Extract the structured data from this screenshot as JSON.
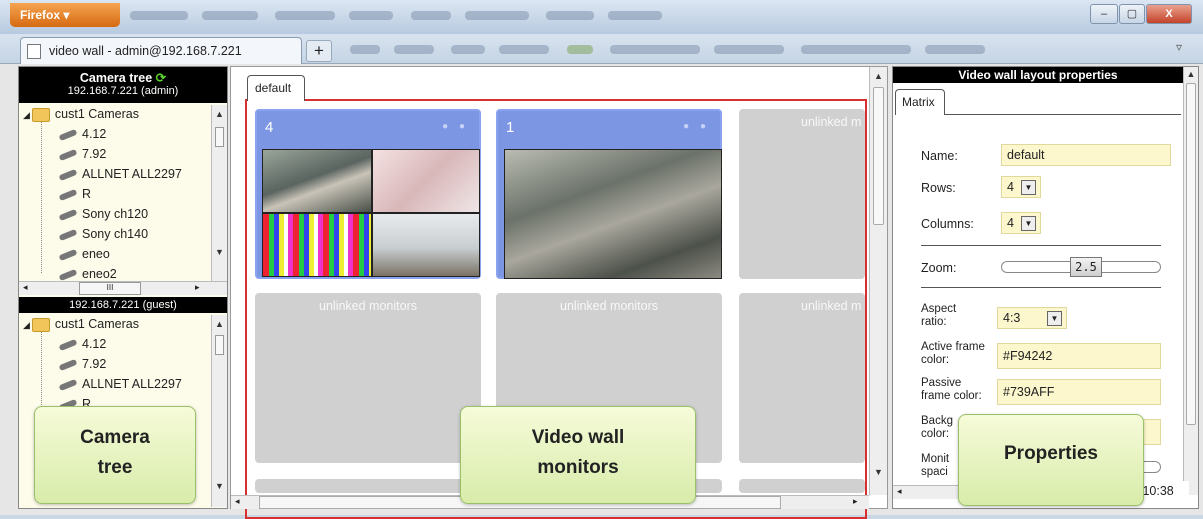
{
  "browser": {
    "app_button": "Firefox",
    "tab_title": "video wall - admin@192.168.7.221",
    "new_tab_symbol": "+",
    "window_controls": {
      "minimize": "–",
      "maximize": "▢",
      "close": "X"
    }
  },
  "camera_tree": {
    "title": "Camera tree",
    "servers": [
      {
        "address": "192.168.7.221 (admin)",
        "folder": "cust1 Cameras",
        "cameras": [
          "4.12",
          "7.92",
          "ALLNET ALL2297",
          "R",
          "Sony ch120",
          "Sony ch140",
          "eneo",
          "eneo2"
        ]
      },
      {
        "address": "192.168.7.221 (guest)",
        "folder": "cust1 Cameras",
        "cameras": [
          "4.12",
          "7.92",
          "ALLNET ALL2297",
          "R"
        ]
      }
    ],
    "hscroll_grip": "III"
  },
  "video_wall": {
    "layout_tab": "default",
    "monitors": [
      {
        "number": "4",
        "state": "active"
      },
      {
        "number": "1",
        "state": "active"
      },
      {
        "label": "unlinked m"
      },
      {
        "label": "unlinked monitors"
      },
      {
        "label": "unlinked monitors"
      },
      {
        "label": "unlinked m"
      }
    ],
    "hscroll_grip": "III",
    "colors": {
      "active_monitor": "#7d96e4",
      "frame": "#d83030"
    }
  },
  "properties": {
    "title": "Video wall layout properties",
    "tab": "Matrix",
    "name": {
      "label": "Name:",
      "value": "default"
    },
    "rows": {
      "label": "Rows:",
      "value": "4"
    },
    "columns": {
      "label": "Columns:",
      "value": "4"
    },
    "zoom": {
      "label": "Zoom:",
      "value": "2.5"
    },
    "aspect_ratio": {
      "label_1": "Aspect",
      "label_2": "ratio:",
      "value": "4:3"
    },
    "active_frame_color": {
      "label_1": "Active frame",
      "label_2": "color:",
      "value": "#F94242"
    },
    "passive_frame_color": {
      "label_1": "Passive",
      "label_2": "frame color:",
      "value": "#739AFF"
    },
    "background_color": {
      "label_1": "Backg",
      "label_2": "color:"
    },
    "monitor_spacing": {
      "label_1": "Monit",
      "label_2": "spaci"
    },
    "clock": ":10:38"
  },
  "callouts": {
    "camera_tree": [
      "Camera",
      "tree"
    ],
    "video_wall": [
      "Video wall",
      "monitors"
    ],
    "properties": [
      "Properties"
    ]
  }
}
